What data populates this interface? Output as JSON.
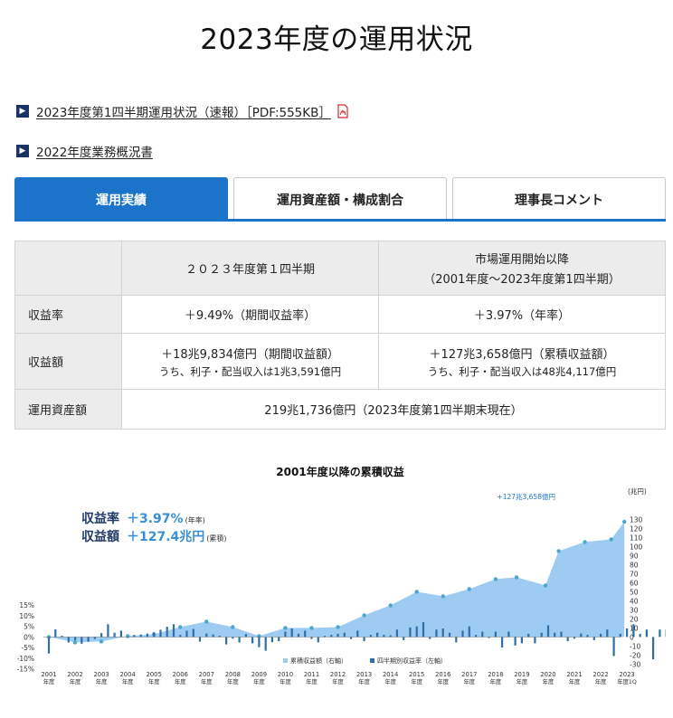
{
  "page": {
    "title": "2023年度の運用状況"
  },
  "links": [
    {
      "label": "2023年度第1四半期運用状況（速報）［PDF:555KB］",
      "icon": "pdf-icon"
    },
    {
      "label": "2022年度業務概況書"
    }
  ],
  "tabs": [
    {
      "label": "運用実績",
      "active": true
    },
    {
      "label": "運用資産額・構成割合",
      "active": false
    },
    {
      "label": "理事長コメント",
      "active": false
    }
  ],
  "summary_table": {
    "col1_header": "２０２３年度第１四半期",
    "col2_header_line1": "市場運用開始以降",
    "col2_header_line2": "（2001年度～2023年度第1四半期）",
    "rows": {
      "return_rate": {
        "label": "収益率",
        "col1": "＋9.49%（期間収益率）",
        "col2": "＋3.97%（年率）"
      },
      "return_amount": {
        "label": "収益額",
        "col1": "＋18兆9,834億円（期間収益額）",
        "col1_sub": "うち、利子・配当収入は1兆3,591億円",
        "col2": "＋127兆3,658億円（累積収益額）",
        "col2_sub": "うち、利子・配当収入は48兆4,117億円"
      },
      "assets": {
        "label": "運用資産額",
        "value": "219兆1,736億円（2023年度第1四半期末現在）"
      }
    }
  },
  "chart_data": {
    "type": "area",
    "title": "2001年度以降の累積収益",
    "box": {
      "line1_label": "収益率",
      "line1_value": "＋3.97%",
      "line1_unit": "(年率)",
      "line2_label": "収益額",
      "line2_value": "＋127.4兆円",
      "line2_unit": "(累積)"
    },
    "annotation": "+127兆3,658億円",
    "right_axis": {
      "unit": "(兆円)",
      "min": -30,
      "max": 130,
      "step": 10
    },
    "left_axis": {
      "min": -15,
      "max": 15,
      "step": 5,
      "suffix": "%"
    },
    "x_labels": [
      {
        "year": "2001",
        "sub": "年度"
      },
      {
        "year": "2002",
        "sub": "年度"
      },
      {
        "year": "2003",
        "sub": "年度"
      },
      {
        "year": "2004",
        "sub": "年度"
      },
      {
        "year": "2005",
        "sub": "年度"
      },
      {
        "year": "2006",
        "sub": "年度"
      },
      {
        "year": "2007",
        "sub": "年度"
      },
      {
        "year": "2008",
        "sub": "年度"
      },
      {
        "year": "2009",
        "sub": "年度"
      },
      {
        "year": "2010",
        "sub": "年度"
      },
      {
        "year": "2011",
        "sub": "年度"
      },
      {
        "year": "2012",
        "sub": "年度"
      },
      {
        "year": "2013",
        "sub": "年度"
      },
      {
        "year": "2014",
        "sub": "年度"
      },
      {
        "year": "2015",
        "sub": "年度"
      },
      {
        "year": "2016",
        "sub": "年度"
      },
      {
        "year": "2017",
        "sub": "年度"
      },
      {
        "year": "2018",
        "sub": "年度"
      },
      {
        "year": "2019",
        "sub": "年度"
      },
      {
        "year": "2020",
        "sub": "年度"
      },
      {
        "year": "2021",
        "sub": "年度"
      },
      {
        "year": "2022",
        "sub": "年度"
      },
      {
        "year": "2023",
        "sub": "年度1Q"
      }
    ],
    "cumulative": {
      "name": "累積収益額（右軸）",
      "color": "#9dcbf2",
      "points": [
        [
          2001.0,
          0
        ],
        [
          2002.0,
          -6
        ],
        [
          2003.0,
          -5
        ],
        [
          2004.0,
          1
        ],
        [
          2005.0,
          3
        ],
        [
          2006.0,
          11
        ],
        [
          2007.0,
          17
        ],
        [
          2008.0,
          11
        ],
        [
          2009.0,
          1
        ],
        [
          2010.0,
          10
        ],
        [
          2011.0,
          10
        ],
        [
          2012.0,
          11
        ],
        [
          2013.0,
          24
        ],
        [
          2014.0,
          35
        ],
        [
          2015.0,
          50
        ],
        [
          2016.0,
          45
        ],
        [
          2017.0,
          53
        ],
        [
          2018.0,
          64
        ],
        [
          2018.8,
          66
        ],
        [
          2019.9,
          57
        ],
        [
          2020.4,
          95
        ],
        [
          2021.4,
          105
        ],
        [
          2022.4,
          108
        ],
        [
          2022.9,
          127.4
        ]
      ],
      "markers": [
        [
          2001.0,
          0
        ],
        [
          2002.0,
          -6
        ],
        [
          2003.0,
          -5
        ],
        [
          2004.0,
          1
        ],
        [
          2005.0,
          3
        ],
        [
          2006.0,
          11
        ],
        [
          2007.0,
          17
        ],
        [
          2008.0,
          11
        ],
        [
          2009.0,
          1
        ],
        [
          2010.0,
          10
        ],
        [
          2011.0,
          10
        ],
        [
          2012.0,
          11
        ],
        [
          2013.0,
          24
        ],
        [
          2014.0,
          35
        ],
        [
          2015.0,
          50
        ],
        [
          2016.0,
          45
        ],
        [
          2017.0,
          53
        ],
        [
          2018.0,
          64
        ],
        [
          2018.8,
          66
        ],
        [
          2019.9,
          57
        ],
        [
          2020.4,
          95
        ],
        [
          2021.4,
          105
        ],
        [
          2022.4,
          108
        ],
        [
          2022.9,
          127.4
        ]
      ]
    },
    "quarterly": {
      "name": "四半期別収益率（左軸）",
      "color": "#2f6ea6",
      "values": [
        -7.8,
        3.6,
        0.6,
        -2.6,
        -1.6,
        -3.2,
        -2.2,
        -1.0,
        1.8,
        6.0,
        2.0,
        3.0,
        -0.4,
        1.0,
        1.2,
        1.6,
        2.2,
        3.4,
        4.8,
        6.0,
        1.0,
        3.0,
        3.8,
        -2.2,
        1.6,
        1.2,
        0.6,
        -3.5,
        -0.8,
        -2.6,
        1.4,
        -3.0,
        -4.8,
        -6.5,
        -2.5,
        -2.0,
        2.5,
        4.0,
        1.5,
        3.0,
        -1.0,
        -2.5,
        0.5,
        1.0,
        1.5,
        2.0,
        -1.0,
        3.0,
        -2.0,
        1.0,
        2.0,
        1.0,
        0.8,
        3.5,
        -1.5,
        4.5,
        5.0,
        7.0,
        -1.0,
        3.5,
        4.0,
        2.0,
        -2.5,
        3.0,
        5.0,
        1.0,
        2.5,
        -0.5,
        2.5,
        -5.0,
        2.5,
        -4.0,
        -3.0,
        1.5,
        -3.0,
        2.0,
        5.5,
        2.0,
        2.5,
        -2.0,
        -0.8,
        1.6,
        1.0,
        -1.5,
        1.5,
        3.5,
        -9.0,
        1.5,
        4.0,
        6.0,
        1.5,
        3.5,
        -10.5,
        3.5,
        3.5,
        5.5,
        3.0,
        7.0,
        1.5,
        4.8,
        4.2,
        4.5,
        -1.0,
        -1.5,
        -1.0,
        -2.0,
        -1.0,
        4.0,
        5.8,
        9.5
      ]
    }
  }
}
